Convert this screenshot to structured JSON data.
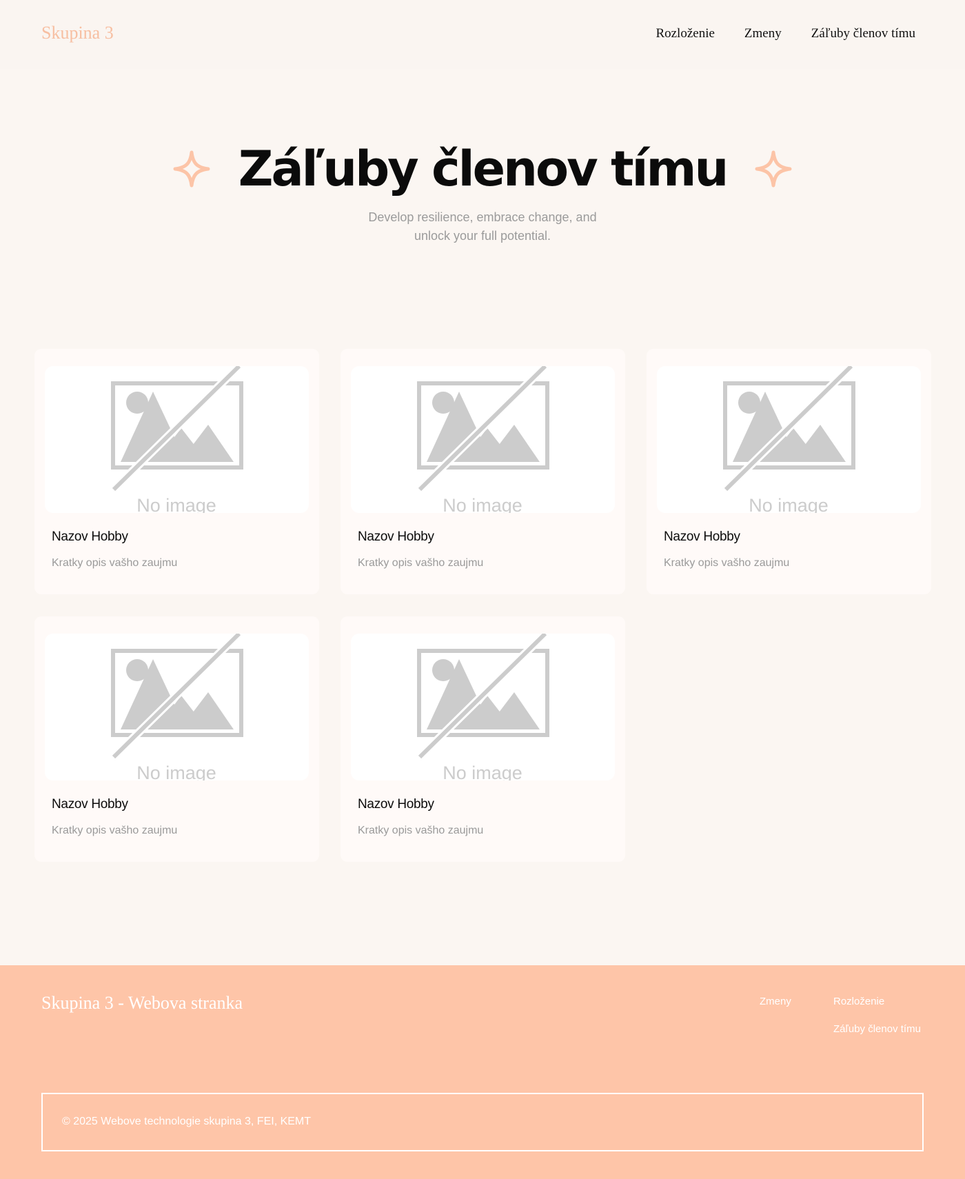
{
  "header": {
    "brand": "Skupina 3",
    "nav": [
      {
        "label": "Rozloženie"
      },
      {
        "label": "Zmeny"
      },
      {
        "label": "Záľuby členov tímu"
      }
    ]
  },
  "hero": {
    "title": "Záľuby členov tímu",
    "subtitle_line1": "Develop resilience, embrace change, and",
    "subtitle_line2": "unlock your full potential."
  },
  "cards": [
    {
      "title": "Nazov Hobby",
      "description": "Kratky opis vašho zaujmu",
      "image_text": "No image"
    },
    {
      "title": "Nazov Hobby",
      "description": "Kratky opis vašho zaujmu",
      "image_text": "No image"
    },
    {
      "title": "Nazov Hobby",
      "description": "Kratky opis vašho zaujmu",
      "image_text": "No image"
    },
    {
      "title": "Nazov Hobby",
      "description": "Kratky opis vašho zaujmu",
      "image_text": "No image"
    },
    {
      "title": "Nazov Hobby",
      "description": "Kratky opis vašho zaujmu",
      "image_text": "No image"
    }
  ],
  "footer": {
    "brand": "Skupina 3 - Webova stranka",
    "links": [
      {
        "label": "Zmeny"
      },
      {
        "label": "Rozloženie"
      },
      {
        "label": "Záľuby členov tímu"
      }
    ],
    "copyright": "© 2025 Webove technologie skupina 3, FEI, KEMT"
  },
  "icons": {
    "hero_left": "sparkle-icon",
    "hero_right": "sparkle-icon",
    "card_image": "no-image-placeholder-icon"
  },
  "colors": {
    "accent": "#fec5a8",
    "brand_text": "#f7bfa2",
    "background": "#fbf6f2",
    "placeholder_gray": "#cccccc"
  }
}
